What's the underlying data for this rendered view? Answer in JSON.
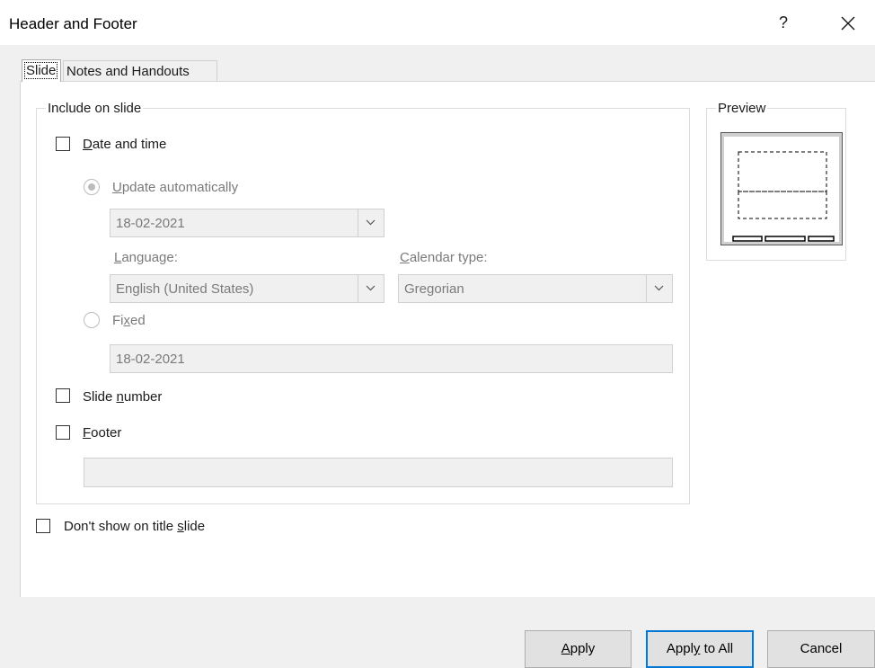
{
  "window": {
    "title": "Header and Footer",
    "help_label": "?"
  },
  "tabs": [
    {
      "label": "Slide",
      "active": true
    },
    {
      "label": "Notes and Handouts",
      "active": false
    }
  ],
  "include_group": {
    "legend": "Include on slide",
    "date_time": {
      "label_pre": "",
      "label_u": "D",
      "label_post": "ate and time",
      "checked": false
    },
    "update_auto": {
      "label_pre": "",
      "label_u": "U",
      "label_post": "pdate automatically",
      "selected": true
    },
    "date_combo": {
      "value": "18-02-2021"
    },
    "language": {
      "label_pre": "",
      "label_u": "L",
      "label_post": "anguage:",
      "value": "English (United States)"
    },
    "calendar": {
      "label_pre": "",
      "label_u": "C",
      "label_post": "alendar type:",
      "value": "Gregorian"
    },
    "fixed": {
      "label_pre": "Fi",
      "label_u": "x",
      "label_post": "ed",
      "selected": false,
      "value": "18-02-2021"
    },
    "slide_number": {
      "label_pre": "Slide ",
      "label_u": "n",
      "label_post": "umber",
      "checked": false
    },
    "footer": {
      "label_pre": "",
      "label_u": "F",
      "label_post": "ooter",
      "checked": false,
      "value": ""
    }
  },
  "preview_group": {
    "legend": "Preview"
  },
  "dont_show": {
    "label_pre": "Don't show on title ",
    "label_u": "s",
    "label_post": "lide",
    "checked": false
  },
  "buttons": {
    "apply": {
      "pre": "",
      "u": "A",
      "post": "pply"
    },
    "apply_all": {
      "pre": "Appl",
      "u": "y",
      "post": " to All"
    },
    "cancel": {
      "label": "Cancel"
    }
  },
  "colors": {
    "accent": "#0078d7",
    "panel": "#ffffff",
    "dialog_bg": "#f0f0f0"
  }
}
